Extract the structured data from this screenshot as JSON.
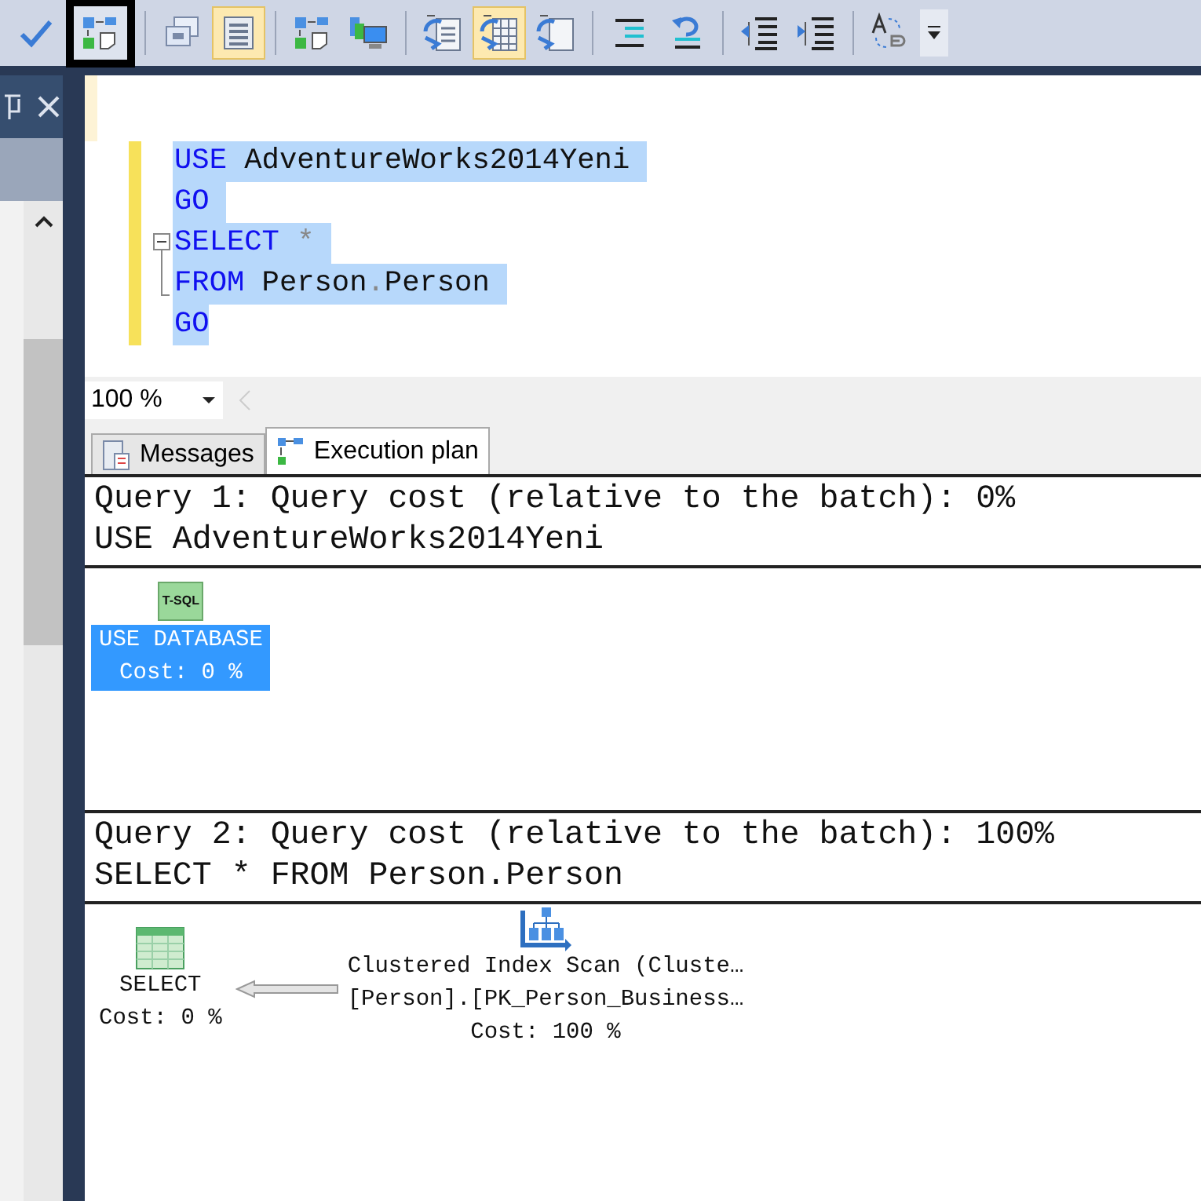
{
  "toolbar": {
    "buttons": [
      {
        "kind": "check",
        "active": false,
        "framed": false
      },
      {
        "kind": "plan",
        "active": false,
        "framed": true
      },
      {
        "kind": "windows",
        "active": false,
        "framed": false
      },
      {
        "kind": "form",
        "active": true,
        "framed": false
      },
      {
        "kind": "plan",
        "active": false,
        "framed": false
      },
      {
        "kind": "monitor",
        "active": false,
        "framed": false
      },
      {
        "kind": "doc",
        "active": false,
        "framed": false
      },
      {
        "kind": "grid",
        "active": true,
        "framed": false
      },
      {
        "kind": "file",
        "active": false,
        "framed": false
      },
      {
        "kind": "lines",
        "active": false,
        "framed": false
      },
      {
        "kind": "undo",
        "active": false,
        "framed": false
      },
      {
        "kind": "outdent",
        "active": false,
        "framed": false
      },
      {
        "kind": "indent",
        "active": false,
        "framed": false
      },
      {
        "kind": "ab",
        "active": false,
        "framed": false
      },
      {
        "kind": "more",
        "active": false,
        "framed": false
      }
    ]
  },
  "editor": {
    "lines": [
      {
        "selected": true,
        "fold_start": false,
        "fold_end": false,
        "tokens": [
          {
            "kind": "keyword",
            "text": "USE"
          },
          {
            "kind": "ident",
            "text": " AdventureWorks2014Yeni "
          }
        ]
      },
      {
        "selected": true,
        "fold_start": false,
        "fold_end": false,
        "tokens": [
          {
            "kind": "keyword",
            "text": "GO "
          }
        ]
      },
      {
        "selected": true,
        "fold_start": true,
        "fold_end": false,
        "tokens": [
          {
            "kind": "keyword",
            "text": "SELECT"
          },
          {
            "kind": "operator",
            "text": " * "
          }
        ]
      },
      {
        "selected": true,
        "fold_start": false,
        "fold_end": true,
        "tokens": [
          {
            "kind": "keyword",
            "text": "FROM"
          },
          {
            "kind": "ident",
            "text": " Person"
          },
          {
            "kind": "operator",
            "text": "."
          },
          {
            "kind": "ident",
            "text": "Person "
          }
        ]
      },
      {
        "selected": true,
        "fold_start": false,
        "fold_end": false,
        "tokens": [
          {
            "kind": "keyword",
            "text": "GO"
          }
        ]
      }
    ],
    "zoom": "100 %"
  },
  "tabs": [
    {
      "label": "Messages",
      "selected": false,
      "kind": "messages"
    },
    {
      "label": "Execution plan",
      "selected": true,
      "kind": "plan"
    }
  ],
  "queries": [
    {
      "header": "Query 1: Query cost (relative to the batch): 0%",
      "sql": "USE AdventureWorks2014Yeni",
      "nodes": [
        {
          "kind": "tsql",
          "icon_text": "T-SQL",
          "lines": [
            "USE DATABASE"
          ],
          "cost": "Cost: 0 %",
          "selected": true
        }
      ]
    },
    {
      "header": "Query 2: Query cost (relative to the batch): 100%",
      "sql": "SELECT * FROM Person.Person",
      "nodes": [
        {
          "kind": "select",
          "lines": [
            "SELECT"
          ],
          "cost": "Cost: 0 %",
          "selected": false
        },
        {
          "kind": "scan",
          "lines": [
            "Clustered Index Scan (Cluste…",
            "[Person].[PK_Person_Business…"
          ],
          "cost": "Cost: 100 %",
          "selected": false
        }
      ]
    }
  ]
}
